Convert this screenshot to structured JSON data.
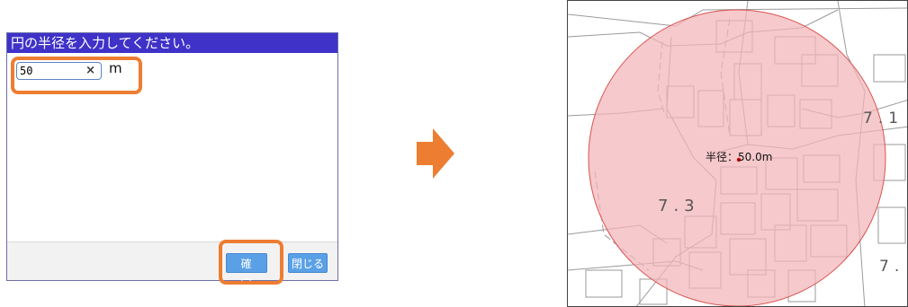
{
  "dialog": {
    "title": "円の半径を入力してください。",
    "input_value": "50",
    "clear_glyph": "×",
    "unit": "m",
    "confirm_label": "確 定",
    "close_label": "閉じる"
  },
  "arrow": {
    "icon": "arrow-right-icon",
    "color": "#ed7d31"
  },
  "map": {
    "radius_label": "半径：50.0m",
    "block_label": "7.3",
    "block_label_2": "7.1",
    "block_label_3": "7."
  },
  "colors": {
    "title_bar": "#3f32c8",
    "highlight": "#ed7d31",
    "button": "#5aa0e6",
    "circle_fill": "#f3b4b8",
    "circle_stroke": "#d9534f"
  }
}
